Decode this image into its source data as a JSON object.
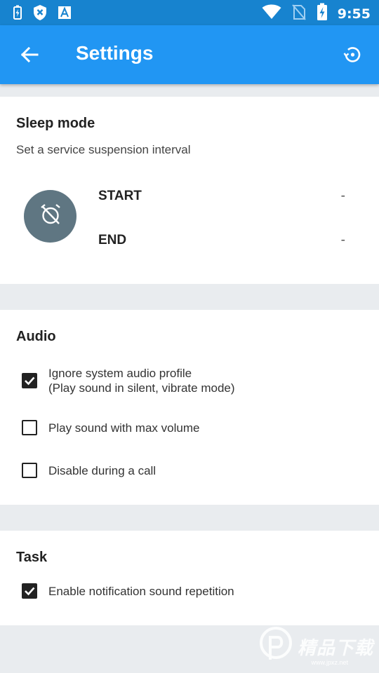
{
  "status_bar": {
    "time": "9:55",
    "icons": [
      "battery-saver-icon",
      "shield-x-icon",
      "font-a-icon",
      "wifi-icon",
      "no-sim-icon",
      "battery-charging-icon"
    ]
  },
  "app_bar": {
    "title": "Settings",
    "back_icon": "arrow-left-icon",
    "restore_icon": "restore-icon"
  },
  "sleep_mode": {
    "title": "Sleep mode",
    "subtitle": "Set a service suspension interval",
    "icon": "alarm-off-icon",
    "start_label": "START",
    "start_value": "-",
    "end_label": "END",
    "end_value": "-"
  },
  "audio": {
    "title": "Audio",
    "options": [
      {
        "label_line1": "Ignore system audio profile",
        "label_line2": "(Play sound in silent, vibrate mode)",
        "checked": true
      },
      {
        "label_line1": "Play sound with max volume",
        "checked": false
      },
      {
        "label_line1": "Disable during a call",
        "checked": false
      }
    ]
  },
  "task": {
    "title": "Task",
    "options": [
      {
        "label_line1": "Enable notification sound repetition",
        "checked": true
      }
    ]
  },
  "watermark": {
    "text": "精品下载",
    "small": "www.jpxz.net"
  },
  "colors": {
    "status_bar": "#1783cf",
    "app_bar": "#2196f3",
    "background": "#e9ecef",
    "clock_circle": "#5f7682"
  }
}
